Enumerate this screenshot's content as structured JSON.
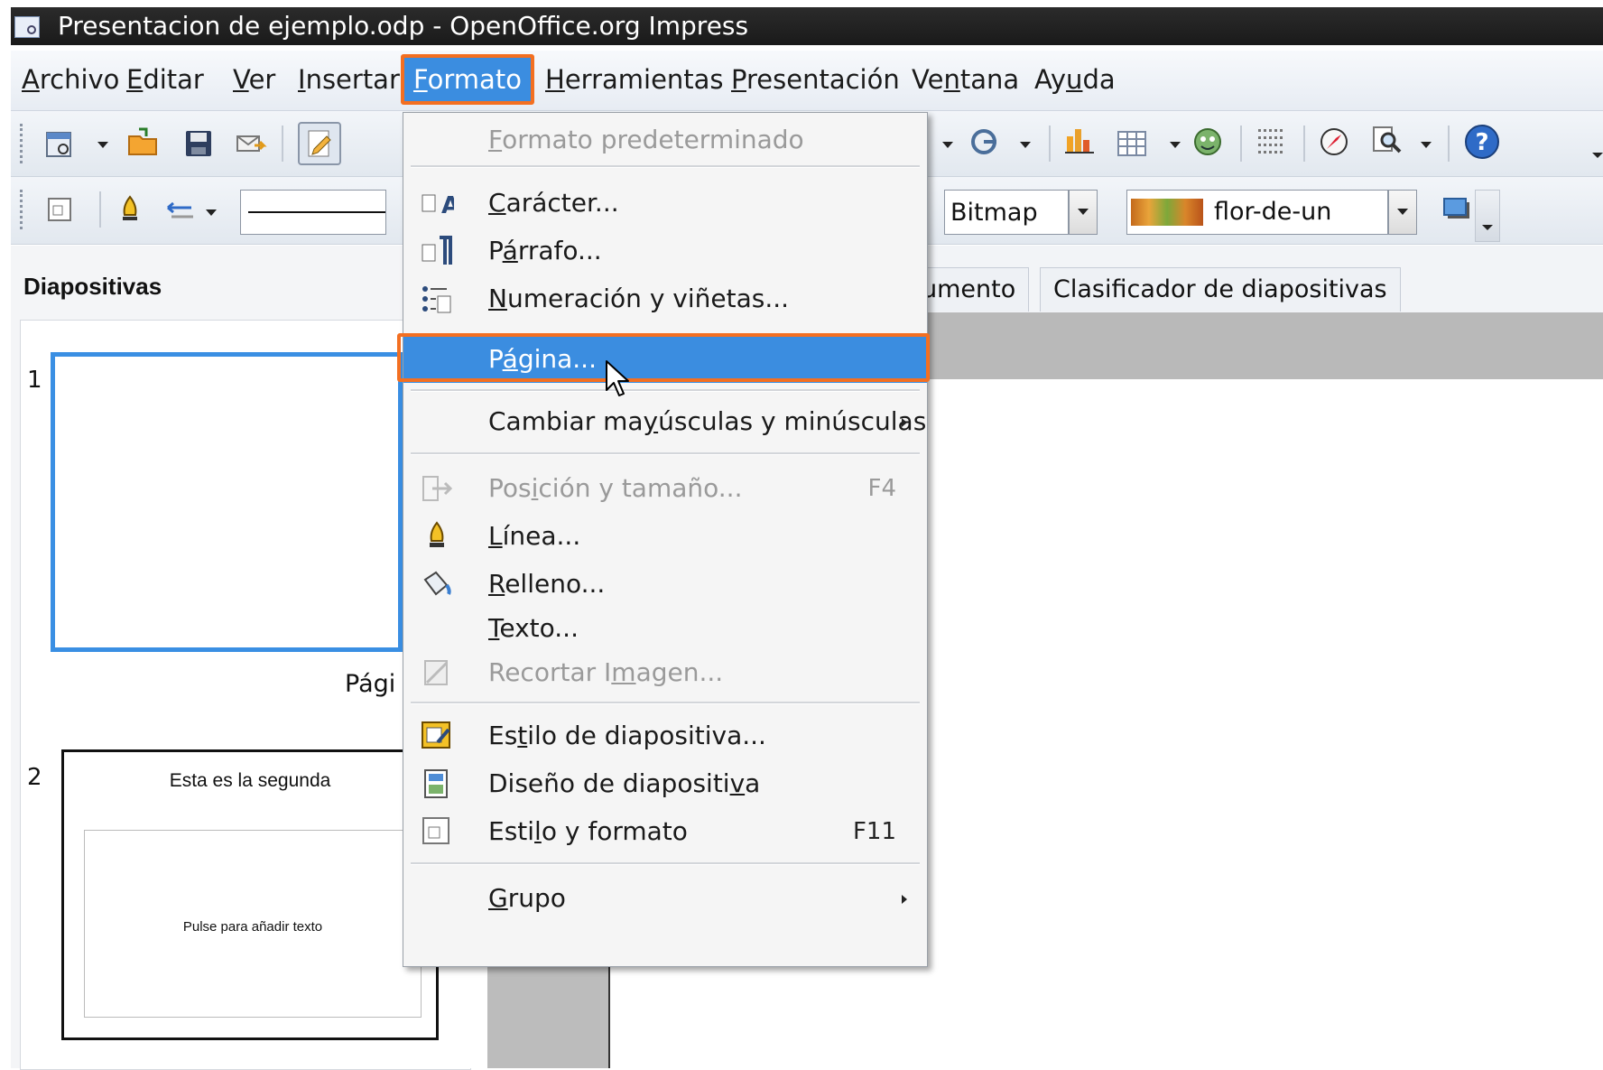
{
  "window": {
    "title": "Presentacion de ejemplo.odp - OpenOffice.org Impress"
  },
  "menubar": {
    "items": [
      {
        "id": "archivo",
        "pre": "",
        "u": "A",
        "post": "rchivo"
      },
      {
        "id": "editar",
        "pre": "",
        "u": "E",
        "post": "ditar"
      },
      {
        "id": "ver",
        "pre": "",
        "u": "V",
        "post": "er"
      },
      {
        "id": "insertar",
        "pre": "",
        "u": "I",
        "post": "nsertar"
      },
      {
        "id": "formato",
        "pre": "",
        "u": "F",
        "post": "ormato"
      },
      {
        "id": "herramientas",
        "pre": "",
        "u": "H",
        "post": "erramientas"
      },
      {
        "id": "presentacion",
        "pre": "",
        "u": "P",
        "post": "resentación"
      },
      {
        "id": "ventana",
        "pre": "Ve",
        "u": "n",
        "post": "tana"
      },
      {
        "id": "ayuda",
        "pre": "Ay",
        "u": "u",
        "post": "da"
      }
    ]
  },
  "toolbar2": {
    "area_style": "Bitmap",
    "bitmap_name": "flor-de-un"
  },
  "slides_panel": {
    "title": "Diapositivas",
    "slide1_number": "1",
    "slide1_caption": "Pági",
    "slide2_number": "2",
    "slide2_title": "Esta es la segunda",
    "slide2_placeholder": "Pulse para añadir texto"
  },
  "tabs": {
    "partial_tab": "umento",
    "sorter_tab": "Clasificador de diapositivas"
  },
  "format_menu": {
    "items": {
      "formato_predeterminado": {
        "pre": "",
        "u": "F",
        "post": "ormato predeterminado"
      },
      "caracter": {
        "pre": "",
        "u": "C",
        "post": "arácter..."
      },
      "parrafo": {
        "pre": "P",
        "u": "á",
        "post": "rrafo..."
      },
      "numeracion": {
        "pre": "",
        "u": "N",
        "post": "umeración y viñetas..."
      },
      "pagina": {
        "pre": "P",
        "u": "á",
        "post": "gina..."
      },
      "cambiar": {
        "pre": "Cambiar ma",
        "u": "y",
        "post": "úsculas y minúsculas"
      },
      "posicion": {
        "pre": "Pos",
        "u": "i",
        "post": "ción y tamaño..."
      },
      "posicion_shortcut": "F4",
      "linea": {
        "pre": "",
        "u": "L",
        "post": "ínea..."
      },
      "relleno": {
        "pre": "",
        "u": "R",
        "post": "elleno..."
      },
      "texto": {
        "pre": "",
        "u": "T",
        "post": "exto..."
      },
      "recortar": {
        "pre": "Recortar I",
        "u": "m",
        "post": "agen..."
      },
      "estilo_diapositiva": {
        "pre": "Es",
        "u": "t",
        "post": "ilo de diapositiva..."
      },
      "diseno": {
        "pre": "Diseño de diapositi",
        "u": "v",
        "post": "a"
      },
      "estilo_formato": {
        "pre": "Esti",
        "u": "l",
        "post": "o y formato"
      },
      "estilo_formato_shortcut": "F11",
      "grupo": {
        "pre": "",
        "u": "G",
        "post": "rupo"
      }
    }
  },
  "colors": {
    "highlight": "#3b8de0",
    "annotation": "#f36f21"
  }
}
